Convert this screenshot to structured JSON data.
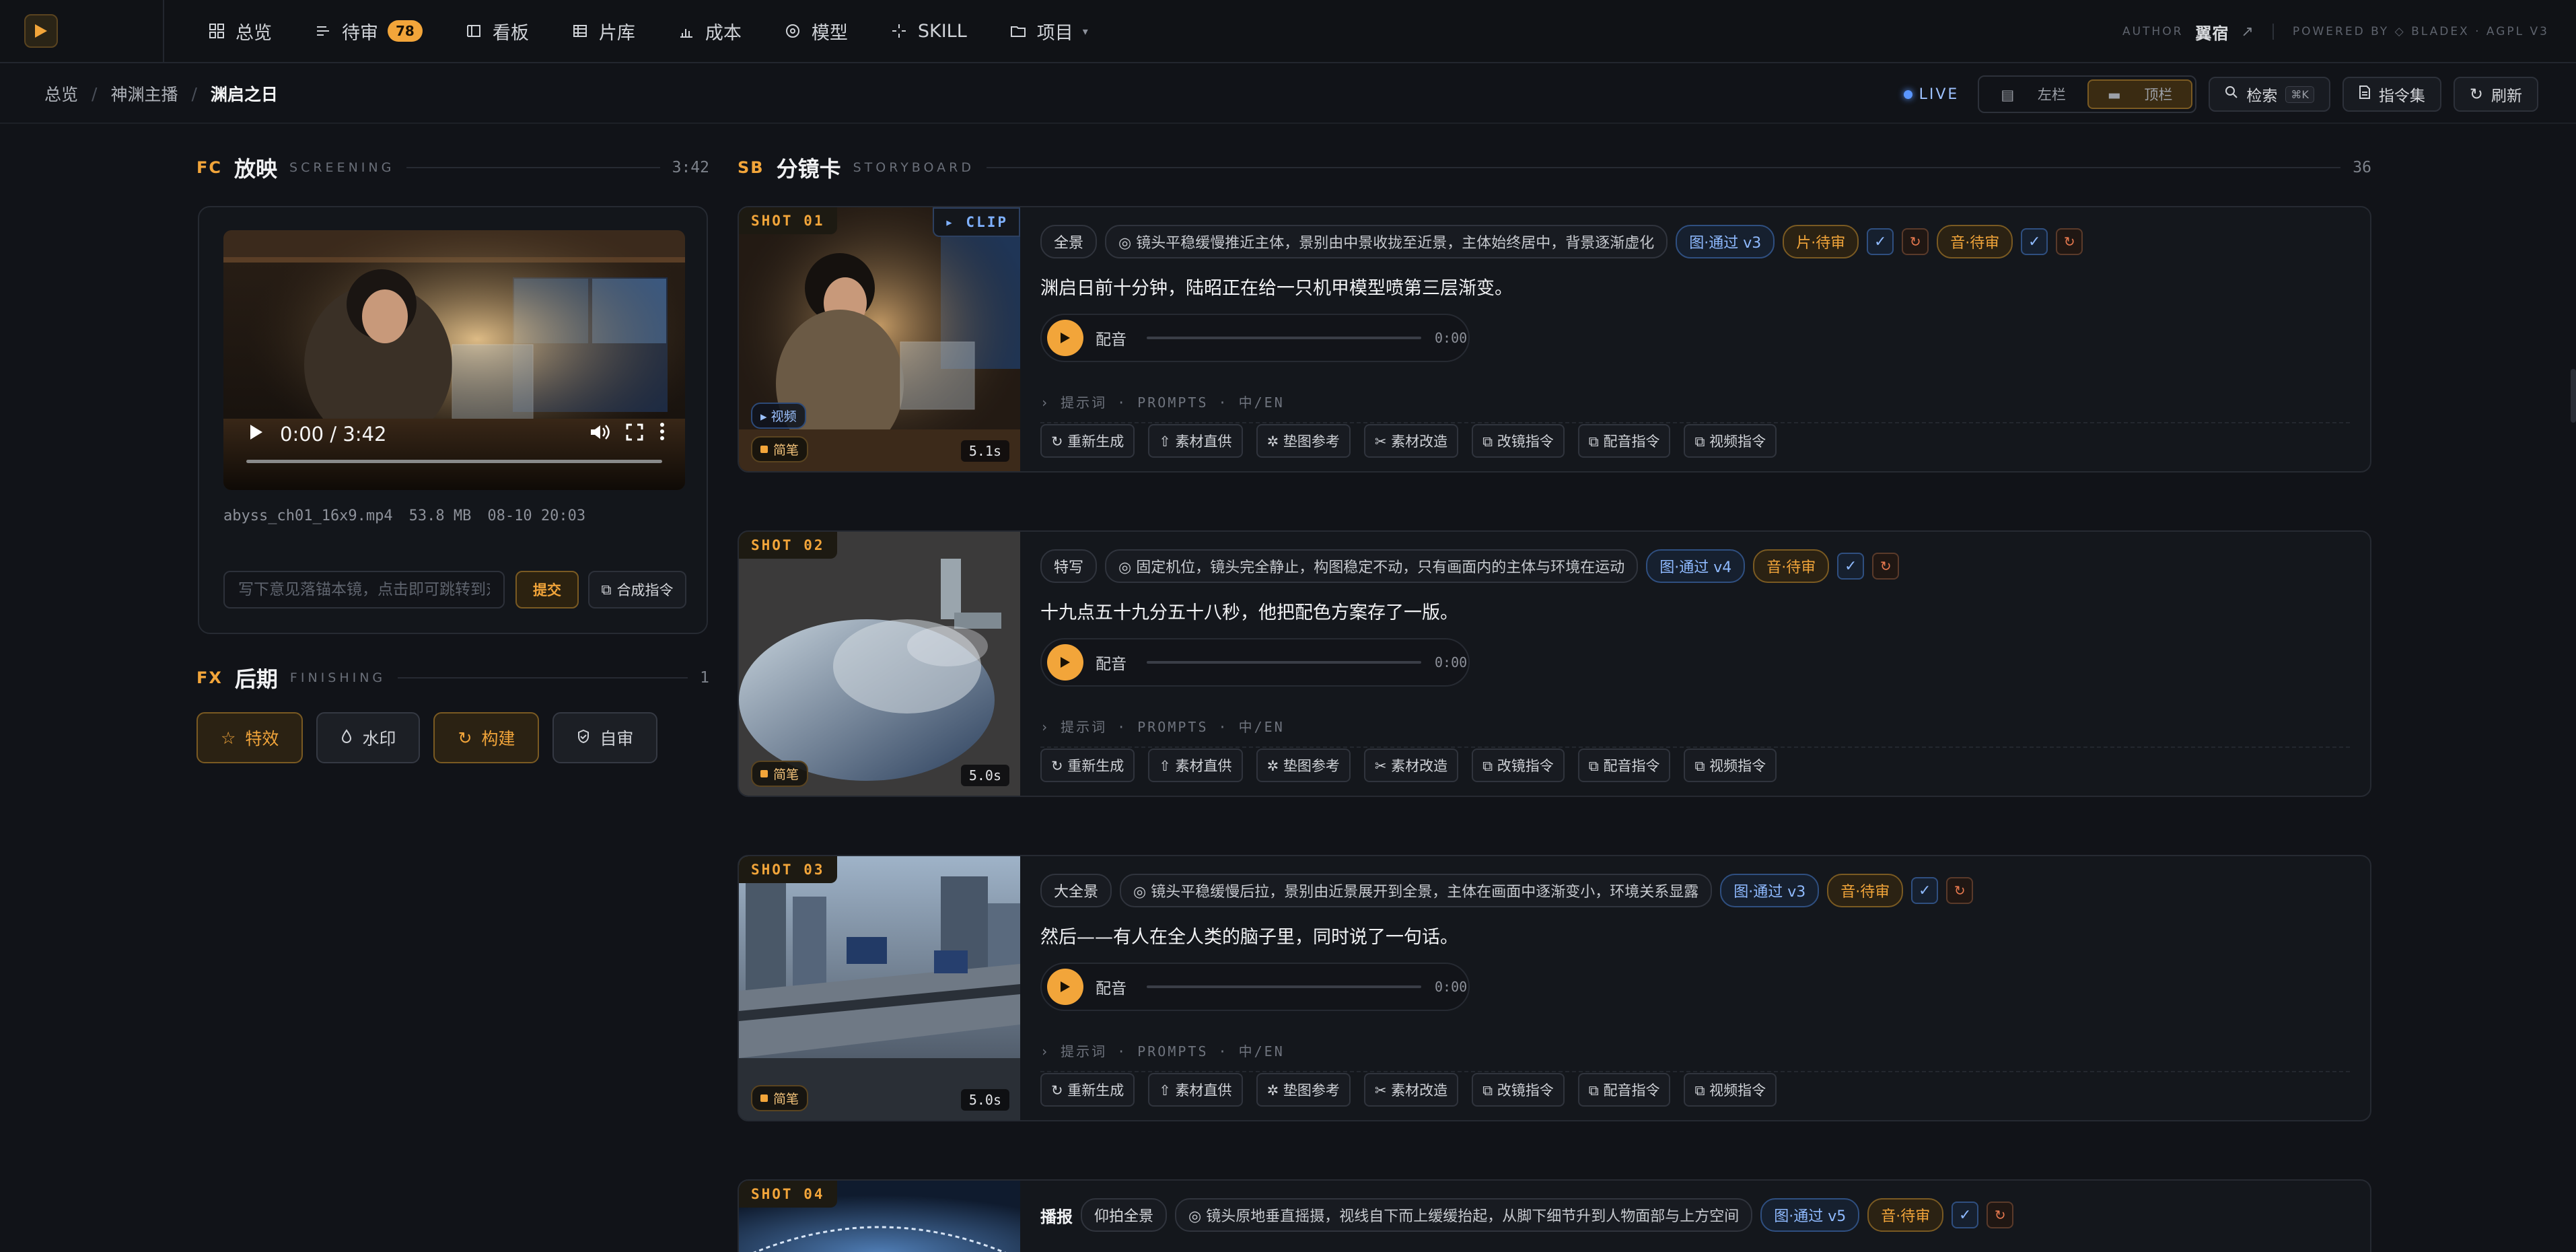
{
  "nav": {
    "items": [
      {
        "label": "总览",
        "icon": "grid-icon"
      },
      {
        "label": "待审",
        "icon": "list-icon",
        "badge": "78"
      },
      {
        "label": "看板",
        "icon": "board-icon"
      },
      {
        "label": "片库",
        "icon": "film-icon"
      },
      {
        "label": "成本",
        "icon": "chart-icon"
      },
      {
        "label": "模型",
        "icon": "model-icon"
      },
      {
        "label": "SKILL",
        "icon": "sparkle-icon"
      },
      {
        "label": "项目",
        "icon": "folder-icon"
      }
    ],
    "author_label": "AUTHOR",
    "author_name": "翼宿",
    "powered": "POWERED BY ◇ BLADEX · AGPL V3"
  },
  "breadcrumb": {
    "items": [
      "总览",
      "神渊主播",
      "渊启之日"
    ]
  },
  "toolbar": {
    "live": "LIVE",
    "layout_left": "左栏",
    "layout_top": "顶栏",
    "search": "检索",
    "search_kbd": "⌘K",
    "commands": "指令集",
    "refresh": "刷新"
  },
  "screening": {
    "code": "FC",
    "title": "放映",
    "sub": "SCREENING",
    "duration": "3:42",
    "video_time": "0:00 / 3:42",
    "file_name": "abyss_ch01_16x9.mp4",
    "file_size": "53.8 MB",
    "file_date": "08-10 20:03",
    "feedback_placeholder": "写下意见落锚本镜，点击即可跳转到对应时刻",
    "submit": "提交",
    "synth": "合成指令"
  },
  "finishing": {
    "code": "FX",
    "title": "后期",
    "sub": "FINISHING",
    "count": "1",
    "buttons": [
      {
        "label": "特效",
        "icon": "star-icon"
      },
      {
        "label": "水印",
        "icon": "drop-icon"
      },
      {
        "label": "构建",
        "icon": "refresh-icon"
      },
      {
        "label": "自审",
        "icon": "shield-icon"
      }
    ]
  },
  "storyboard": {
    "code": "SB",
    "title": "分镜卡",
    "sub": "STORYBOARD",
    "count": "36",
    "voice_label": "配音",
    "voice_time": "0:00",
    "prompt_label": "› 提示词 · PROMPTS · 中/EN",
    "commands": [
      "↻ 重新生成",
      "⇧ 素材直供",
      "✲ 垫图参考",
      "✂ 素材改造",
      "⧉ 改镜指令",
      "⧉ 配音指令",
      "⧉ 视频指令"
    ],
    "check": "✓",
    "reload": "↻",
    "shots": [
      {
        "label": "SHOT 01",
        "clip": "▸ CLIP",
        "duration": "5.1s",
        "video_chip": "▸ 视频",
        "sketch_chip": "简笔",
        "shot_type": "全景",
        "camera": "◎ 镜头平稳缓慢推近主体，景别由中景收拢至近景，主体始终居中，背景逐渐虚化",
        "img_status": "图·通过 v3",
        "clip_status": "片·待审",
        "audio_status": "音·待审",
        "text": "渊启日前十分钟，陆昭正在给一只机甲模型喷第三层渐变。"
      },
      {
        "label": "SHOT 02",
        "duration": "5.0s",
        "sketch_chip": "简笔",
        "shot_type": "特写",
        "camera": "◎ 固定机位，镜头完全静止，构图稳定不动，只有画面内的主体与环境在运动",
        "img_status": "图·通过 v4",
        "audio_status": "音·待审",
        "text": "十九点五十九分五十八秒，他把配色方案存了一版。"
      },
      {
        "label": "SHOT 03",
        "duration": "5.0s",
        "sketch_chip": "简笔",
        "shot_type": "大全景",
        "camera": "◎ 镜头平稳缓慢后拉，景别由近景展开到全景，主体在画面中逐渐变小，环境关系显露",
        "img_status": "图·通过 v3",
        "audio_status": "音·待审",
        "text": "然后——有人在全人类的脑子里，同时说了一句话。"
      },
      {
        "label": "SHOT 04",
        "prefix": "播报",
        "shot_type": "仰拍全景",
        "camera": "◎ 镜头原地垂直摇摄，视线自下而上缓缓抬起，从脚下细节升到人物面部与上方空间",
        "img_status": "图·通过 v5",
        "audio_status": "音·待审"
      }
    ]
  }
}
